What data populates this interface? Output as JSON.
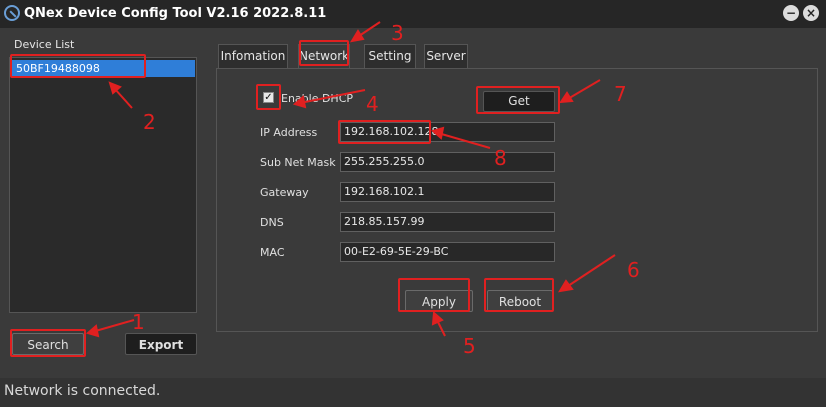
{
  "window": {
    "title": "QNex Device Config Tool V2.16   2022.8.11"
  },
  "titlebar_buttons": {
    "minimize": "−",
    "close": "×"
  },
  "device_list": {
    "label": "Device List",
    "items": [
      "50BF19488098"
    ]
  },
  "left_buttons": {
    "search": "Search",
    "export": "Export"
  },
  "tabs": [
    "Infomation",
    "Network",
    "Setting",
    "Server"
  ],
  "network": {
    "dhcp_label": "Enable DHCP",
    "dhcp_checked": true,
    "get_label": "Get",
    "ip_label": "IP Address",
    "ip_value": "192.168.102.128",
    "mask_label": "Sub Net Mask",
    "mask_value": "255.255.255.0",
    "gateway_label": "Gateway",
    "gateway_value": "192.168.102.1",
    "dns_label": "DNS",
    "dns_value": "218.85.157.99",
    "mac_label": "MAC",
    "mac_value": "00-E2-69-5E-29-BC",
    "apply_label": "Apply",
    "reboot_label": "Reboot"
  },
  "status": {
    "text": "Network is connected."
  },
  "annotations": [
    "1",
    "2",
    "3",
    "4",
    "5",
    "6",
    "7",
    "8"
  ],
  "colors": {
    "highlight": "#e02020",
    "selection": "#2f7ed8"
  },
  "icons": {
    "app": "app-logo-icon",
    "check": "check-icon"
  }
}
